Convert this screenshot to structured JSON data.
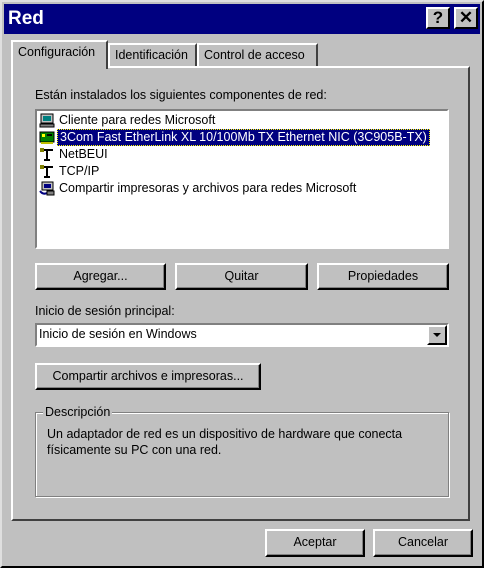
{
  "window": {
    "title": "Red",
    "help_button": "?",
    "close_button": "✕"
  },
  "tabs": [
    {
      "label": "Configuración",
      "active": true
    },
    {
      "label": "Identificación",
      "active": false
    },
    {
      "label": "Control de acceso",
      "active": false
    }
  ],
  "components_label": "Están instalados los siguientes componentes de red:",
  "components": [
    {
      "label": "Cliente para redes Microsoft",
      "icon": "network-client-icon",
      "selected": false
    },
    {
      "label": "3Com Fast EtherLink XL 10/100Mb TX Ethernet NIC (3C905B-TX)",
      "icon": "network-adapter-icon",
      "selected": true
    },
    {
      "label": "NetBEUI",
      "icon": "protocol-icon",
      "selected": false
    },
    {
      "label": "TCP/IP",
      "icon": "protocol-icon",
      "selected": false
    },
    {
      "label": "Compartir impresoras y archivos para redes Microsoft",
      "icon": "file-printer-sharing-icon",
      "selected": false
    }
  ],
  "buttons": {
    "add": "Agregar...",
    "remove": "Quitar",
    "properties": "Propiedades",
    "share": "Compartir archivos e impresoras...",
    "ok": "Aceptar",
    "cancel": "Cancelar"
  },
  "logon": {
    "label": "Inicio de sesión principal:",
    "value": "Inicio de sesión en Windows"
  },
  "description": {
    "legend": "Descripción",
    "text": "Un adaptador de red es un dispositivo de hardware que conecta físicamente su PC con una red."
  }
}
